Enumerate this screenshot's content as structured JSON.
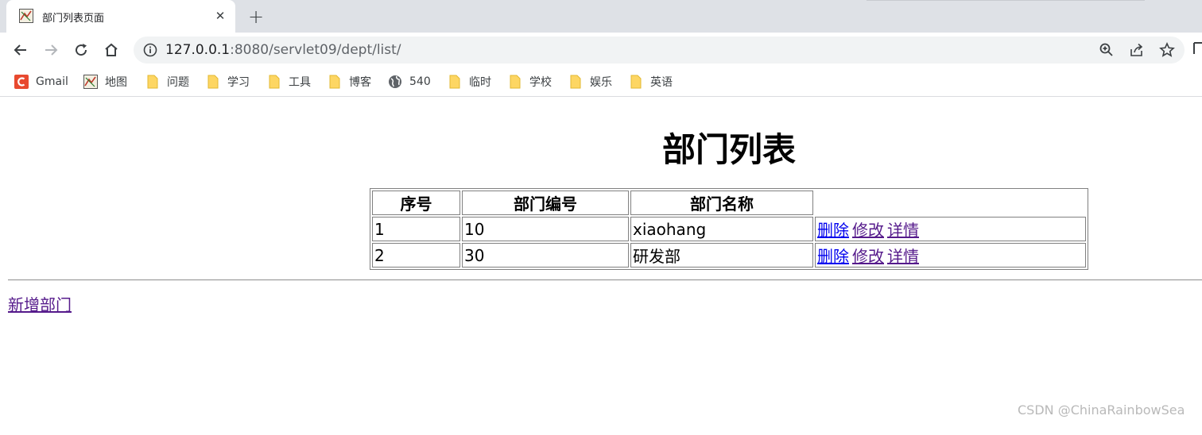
{
  "browser": {
    "tab": {
      "title": "部门列表页面",
      "favicon": "map-favicon-icon",
      "close_icon": "close-icon"
    },
    "new_tab_icon": "plus-icon",
    "nav": {
      "back_icon": "arrow-left-icon",
      "forward_icon": "arrow-right-icon",
      "reload_icon": "reload-icon",
      "home_icon": "home-icon"
    },
    "omnibox": {
      "host": "127.0.0.1",
      "rest": ":8080/servlet09/dept/list/",
      "info_icon": "info-icon",
      "zoom_icon": "zoom-icon",
      "share_icon": "share-icon",
      "star_icon": "star-icon"
    },
    "bookmarks": [
      {
        "label": "Gmail",
        "icon": "gmail-icon"
      },
      {
        "label": "地图",
        "icon": "map-icon"
      },
      {
        "label": "问题",
        "icon": "folder-icon"
      },
      {
        "label": "学习",
        "icon": "folder-icon"
      },
      {
        "label": "工具",
        "icon": "folder-icon"
      },
      {
        "label": "博客",
        "icon": "folder-icon"
      },
      {
        "label": "540",
        "icon": "globe-icon"
      },
      {
        "label": "临时",
        "icon": "folder-icon"
      },
      {
        "label": "学校",
        "icon": "folder-icon"
      },
      {
        "label": "娱乐",
        "icon": "folder-icon"
      },
      {
        "label": "英语",
        "icon": "folder-icon"
      }
    ],
    "colors": {
      "tabstrip": "#dee1e6",
      "omnibox": "#f1f3f4",
      "folder": "#fdd663",
      "link": "#0000ee",
      "visited_link": "#551a8b"
    }
  },
  "page": {
    "title": "部门列表",
    "table": {
      "headers": [
        "序号",
        "部门编号",
        "部门名称"
      ],
      "rows": [
        {
          "index": "1",
          "deptno": "10",
          "dname": "xiaohang",
          "actions": {
            "delete": "删除",
            "modify": "修改",
            "detail": "详情"
          }
        },
        {
          "index": "2",
          "deptno": "30",
          "dname": "研发部",
          "actions": {
            "delete": "删除",
            "modify": "修改",
            "detail": "详情"
          }
        }
      ]
    },
    "add_link": "新增部门",
    "watermark": "CSDN @ChinaRainbowSea"
  }
}
